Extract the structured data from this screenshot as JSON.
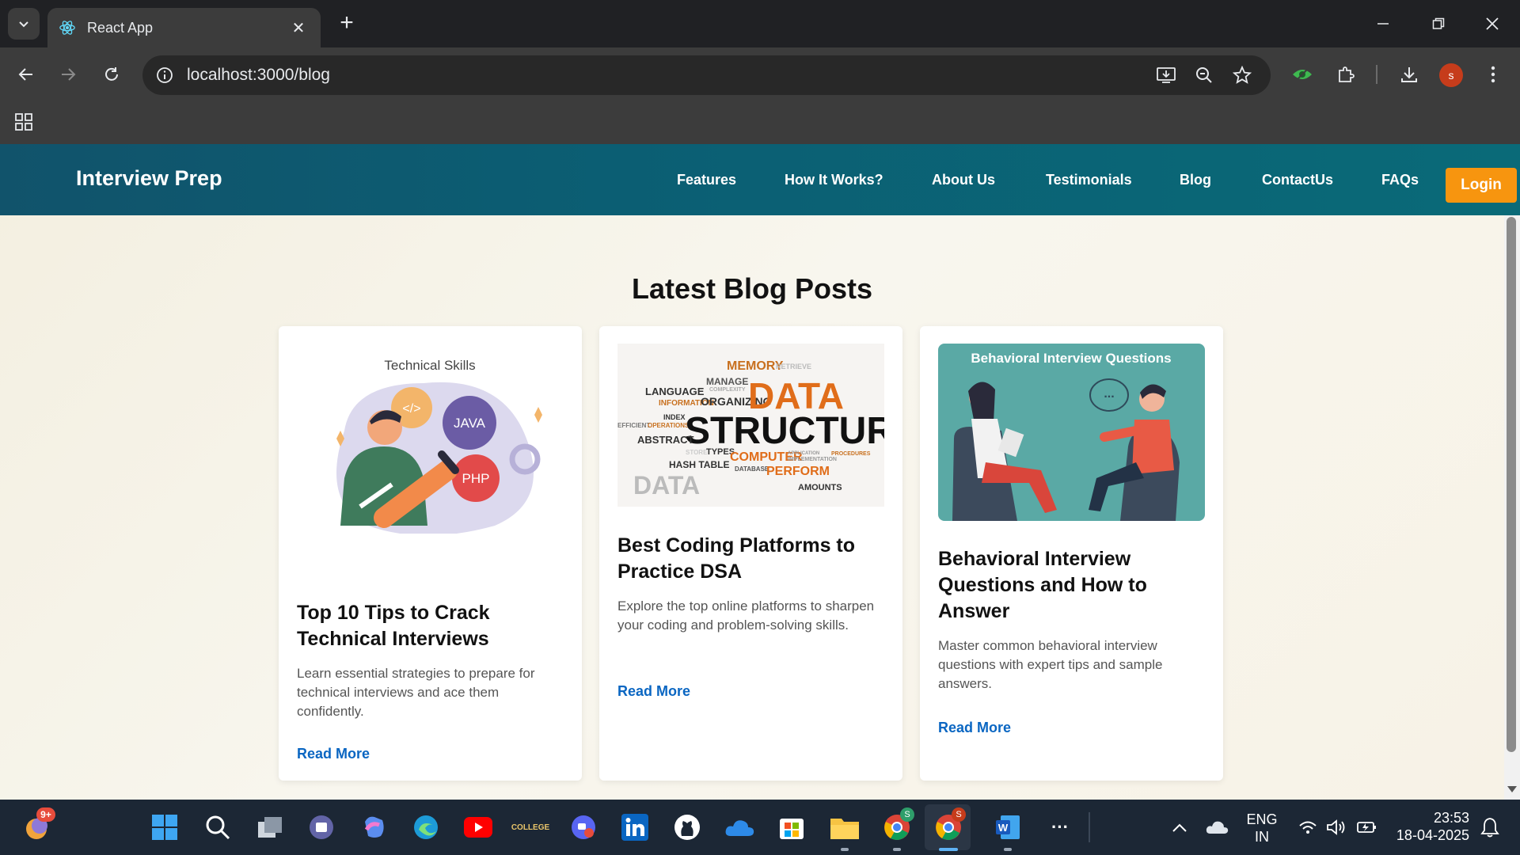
{
  "browser": {
    "tab_title": "React App",
    "url": "localhost:3000/blog",
    "profile_initial": "s"
  },
  "site": {
    "brand": "Interview Prep",
    "nav": [
      "Features",
      "How It Works?",
      "About Us",
      "Testimonials",
      "Blog",
      "ContactUs",
      "FAQs"
    ],
    "login_label": "Login"
  },
  "blog": {
    "heading": "Latest Blog Posts",
    "posts": [
      {
        "image_caption": "Technical Skills",
        "image_labels": [
          "JAVA",
          "PHP",
          "</>"
        ],
        "title": "Top 10 Tips to Crack Technical Interviews",
        "excerpt": "Learn essential strategies to prepare for technical interviews and ace them confidently.",
        "link": "Read More"
      },
      {
        "image_words": [
          "MEMORY",
          "RETRIEVE",
          "MANAGE",
          "COMPLEXITY",
          "LANGUAGE",
          "INFORMATION",
          "ORGANIZING",
          "DATA",
          "INDEX",
          "EFFICIENT",
          "OPERATIONS",
          "STRUCTURE",
          "ABSTRACT",
          "STORE",
          "TYPES",
          "COMPUTER",
          "APPLICATION",
          "IMPLEMENTATION",
          "PROCEDURES",
          "HASH TABLE",
          "DATABASE",
          "PERFORM",
          "DATA",
          "AMOUNTS"
        ],
        "title": "Best Coding Platforms to Practice DSA",
        "excerpt": "Explore the top online platforms to sharpen your coding and problem-solving skills.",
        "link": "Read More"
      },
      {
        "image_caption": "Behavioral Interview Questions",
        "image_bubble": "...",
        "title": "Behavioral Interview Questions and How to Answer",
        "excerpt": "Master common behavioral interview questions with expert tips and sample answers.",
        "link": "Read More"
      }
    ]
  },
  "taskbar": {
    "notification_badge": "9+",
    "college_label": "COLLEGE",
    "chrome_badge_1": "S",
    "chrome_badge_2": "S",
    "language": "ENG",
    "region": "IN",
    "time": "23:53",
    "date": "18-04-2025",
    "apps": [
      "weather",
      "start",
      "search",
      "task-view",
      "teams",
      "copilot",
      "edge",
      "youtube",
      "college",
      "app",
      "linkedin",
      "github",
      "onedrive",
      "store",
      "file-explorer",
      "chrome",
      "chrome",
      "word",
      "more"
    ]
  },
  "colors": {
    "header_start": "#11536b",
    "header_end": "#0a6a78",
    "login": "#f7950f",
    "link": "#0a66c2"
  }
}
